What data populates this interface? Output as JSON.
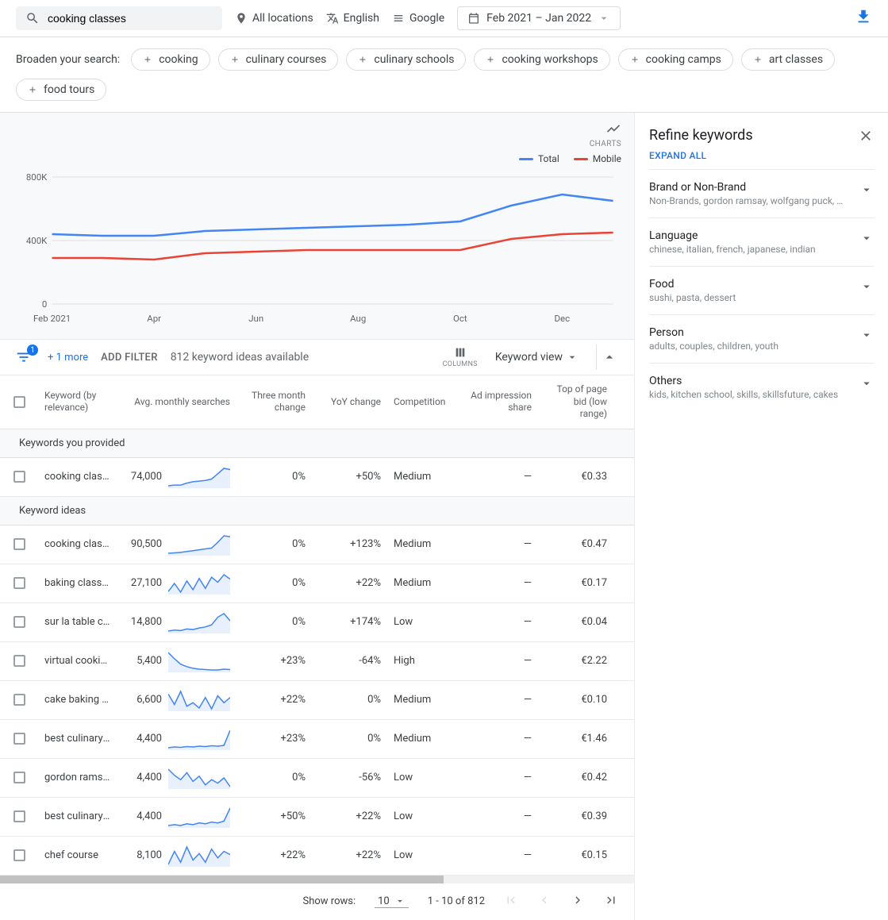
{
  "topbar": {
    "search_value": "cooking classes",
    "location": "All locations",
    "language": "English",
    "network": "Google",
    "date_range": "Feb 2021 – Jan 2022"
  },
  "broaden": {
    "label": "Broaden your search:",
    "chips": [
      "cooking",
      "culinary courses",
      "culinary schools",
      "cooking workshops",
      "cooking camps",
      "art classes",
      "food tours"
    ]
  },
  "chart_data": {
    "type": "line",
    "charts_label": "CHARTS",
    "legend": {
      "total": "Total",
      "mobile": "Mobile"
    },
    "colors": {
      "total": "#4285f4",
      "mobile": "#ea4335"
    },
    "xlabel": "",
    "ylabel": "",
    "y_ticks": [
      "0",
      "400K",
      "800K"
    ],
    "ylim": [
      0,
      800000
    ],
    "categories": [
      "Feb 2021",
      "Mar",
      "Apr",
      "May",
      "Jun",
      "Jul",
      "Aug",
      "Sep",
      "Oct",
      "Nov",
      "Dec",
      "Jan"
    ],
    "x_ticks_shown": [
      "Feb 2021",
      "Apr",
      "Jun",
      "Aug",
      "Oct",
      "Dec"
    ],
    "series": [
      {
        "name": "Total",
        "color": "#4285f4",
        "values": [
          440000,
          430000,
          430000,
          460000,
          470000,
          480000,
          490000,
          500000,
          520000,
          620000,
          690000,
          650000
        ]
      },
      {
        "name": "Mobile",
        "color": "#ea4335",
        "values": [
          290000,
          290000,
          280000,
          320000,
          330000,
          340000,
          340000,
          340000,
          340000,
          410000,
          440000,
          450000
        ]
      }
    ]
  },
  "toolbar": {
    "filter_badge": "1",
    "more": "+ 1 more",
    "add_filter": "ADD FILTER",
    "ideas_available": "812 keyword ideas available",
    "columns_label": "COLUMNS",
    "view": "Keyword view"
  },
  "table": {
    "headers": {
      "keyword": "Keyword (by relevance)",
      "avg": "Avg. monthly searches",
      "three_month": "Three month change",
      "yoy": "YoY change",
      "competition": "Competition",
      "impression": "Ad impression share",
      "bid_low": "Top of page bid (low range)"
    },
    "section_provided": "Keywords you provided",
    "section_ideas": "Keyword ideas",
    "provided": [
      {
        "kw": "cooking clas…",
        "avg": "74,000",
        "spark": [
          40,
          41,
          41,
          44,
          46,
          47,
          48,
          50,
          58,
          66,
          64
        ],
        "tm": "0%",
        "yoy": "+50%",
        "comp": "Medium",
        "imp": "—",
        "bid": "€0.33"
      }
    ],
    "ideas": [
      {
        "kw": "cooking clas…",
        "avg": "90,500",
        "spark": [
          30,
          31,
          32,
          34,
          36,
          38,
          40,
          42,
          55,
          70,
          68
        ],
        "tm": "0%",
        "yoy": "+123%",
        "comp": "Medium",
        "imp": "—",
        "bid": "€0.47"
      },
      {
        "kw": "baking class…",
        "avg": "27,100",
        "spark": [
          35,
          48,
          34,
          52,
          38,
          56,
          40,
          58,
          50,
          62,
          55
        ],
        "tm": "0%",
        "yoy": "+22%",
        "comp": "Medium",
        "imp": "—",
        "bid": "€0.17"
      },
      {
        "kw": "sur la table c…",
        "avg": "14,800",
        "spark": [
          28,
          30,
          29,
          32,
          31,
          34,
          36,
          40,
          55,
          62,
          48
        ],
        "tm": "0%",
        "yoy": "+174%",
        "comp": "Low",
        "imp": "—",
        "bid": "€0.04"
      },
      {
        "kw": "virtual cooki…",
        "avg": "5,400",
        "spark": [
          70,
          55,
          42,
          36,
          32,
          30,
          29,
          28,
          28,
          30,
          29
        ],
        "tm": "+23%",
        "yoy": "-64%",
        "comp": "High",
        "imp": "—",
        "bid": "€2.22"
      },
      {
        "kw": "cake baking …",
        "avg": "6,600",
        "spark": [
          52,
          40,
          55,
          38,
          42,
          36,
          48,
          35,
          50,
          42,
          48
        ],
        "tm": "+22%",
        "yoy": "0%",
        "comp": "Medium",
        "imp": "—",
        "bid": "€0.10"
      },
      {
        "kw": "best culinary …",
        "avg": "4,400",
        "spark": [
          28,
          30,
          29,
          31,
          30,
          32,
          31,
          33,
          32,
          34,
          72
        ],
        "tm": "+23%",
        "yoy": "0%",
        "comp": "Medium",
        "imp": "—",
        "bid": "€1.46"
      },
      {
        "kw": "gordon rams…",
        "avg": "4,400",
        "spark": [
          62,
          55,
          50,
          58,
          48,
          54,
          44,
          50,
          46,
          52,
          42
        ],
        "tm": "0%",
        "yoy": "-56%",
        "comp": "Low",
        "imp": "—",
        "bid": "€0.42"
      },
      {
        "kw": "best culinary …",
        "avg": "4,400",
        "spark": [
          30,
          32,
          30,
          34,
          32,
          36,
          34,
          38,
          36,
          40,
          70
        ],
        "tm": "+50%",
        "yoy": "+22%",
        "comp": "Low",
        "imp": "—",
        "bid": "€0.39"
      },
      {
        "kw": "chef course",
        "avg": "8,100",
        "spark": [
          36,
          48,
          38,
          52,
          40,
          46,
          38,
          50,
          42,
          48,
          45
        ],
        "tm": "+22%",
        "yoy": "+22%",
        "comp": "Low",
        "imp": "—",
        "bid": "€0.15"
      }
    ]
  },
  "pager": {
    "show_rows_label": "Show rows:",
    "page_size": "10",
    "range": "1 - 10 of 812"
  },
  "refine": {
    "title": "Refine keywords",
    "expand_all": "EXPAND ALL",
    "groups": [
      {
        "title": "Brand or Non-Brand",
        "sub": "Non-Brands, gordon ramsay, wolfgang puck, …"
      },
      {
        "title": "Language",
        "sub": "chinese, italian, french, japanese, indian"
      },
      {
        "title": "Food",
        "sub": "sushi, pasta, dessert"
      },
      {
        "title": "Person",
        "sub": "adults, couples, children, youth"
      },
      {
        "title": "Others",
        "sub": "kids, kitchen school, skills, skillsfuture, cakes"
      }
    ]
  }
}
